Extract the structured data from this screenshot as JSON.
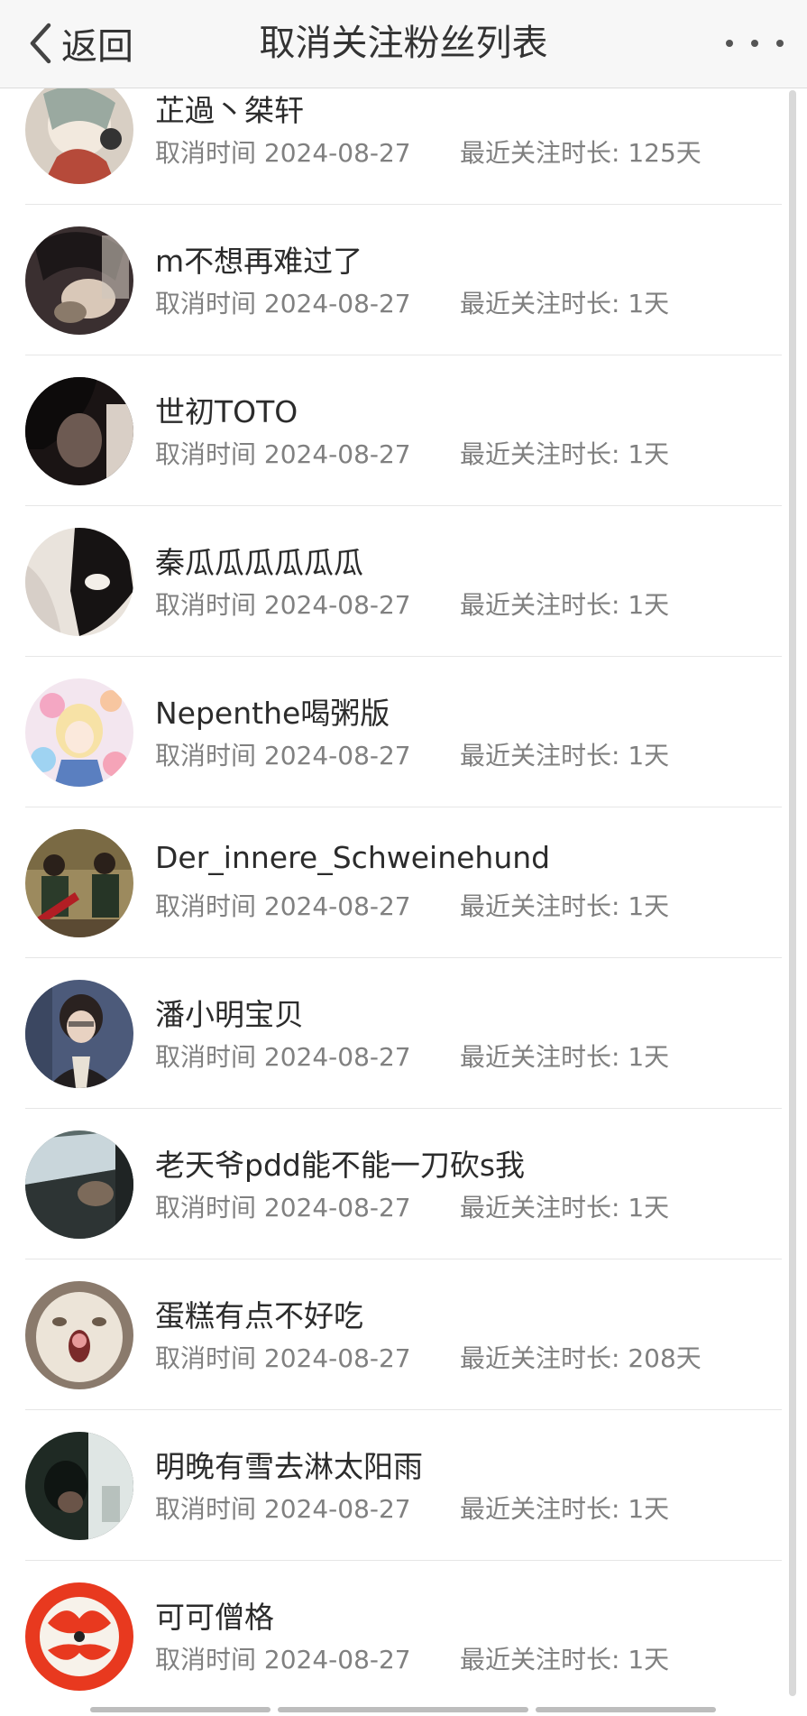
{
  "nav": {
    "back_label": "返回",
    "title": "取消关注粉丝列表"
  },
  "labels": {
    "cancel_time_prefix": "取消时间",
    "duration_prefix": "最近关注时长:"
  },
  "rows": [
    {
      "name": "芷過丶桀轩",
      "cancel_time": "取消时间 2024-08-27",
      "duration": "最近关注时长: 125天"
    },
    {
      "name": "m不想再难过了",
      "cancel_time": "取消时间 2024-08-27",
      "duration": "最近关注时长: 1天"
    },
    {
      "name": "世初TOTO",
      "cancel_time": "取消时间 2024-08-27",
      "duration": "最近关注时长: 1天"
    },
    {
      "name": "秦瓜瓜瓜瓜瓜瓜",
      "cancel_time": "取消时间 2024-08-27",
      "duration": "最近关注时长: 1天"
    },
    {
      "name": "Nepenthe喝粥版",
      "cancel_time": "取消时间 2024-08-27",
      "duration": "最近关注时长: 1天"
    },
    {
      "name": "Der_innere_Schweinehund",
      "cancel_time": "取消时间 2024-08-27",
      "duration": "最近关注时长: 1天"
    },
    {
      "name": "潘小明宝贝",
      "cancel_time": "取消时间 2024-08-27",
      "duration": "最近关注时长: 1天"
    },
    {
      "name": "老天爷pdd能不能一刀砍s我",
      "cancel_time": "取消时间 2024-08-27",
      "duration": "最近关注时长: 1天"
    },
    {
      "name": "蛋糕有点不好吃",
      "cancel_time": "取消时间 2024-08-27",
      "duration": "最近关注时长: 208天"
    },
    {
      "name": "明晚有雪去淋太阳雨",
      "cancel_time": "取消时间 2024-08-27",
      "duration": "最近关注时长: 1天"
    },
    {
      "name": "可可僧格",
      "cancel_time": "取消时间 2024-08-27",
      "duration": "最近关注时长: 1天"
    }
  ],
  "icons": {
    "back": "chevron-left-icon",
    "more": "more-dots-icon"
  },
  "colors": {
    "nav_bg": "#f7f7f7",
    "name_text": "#2b2b2b",
    "meta_text": "#808080",
    "divider": "#e6e6e6"
  }
}
